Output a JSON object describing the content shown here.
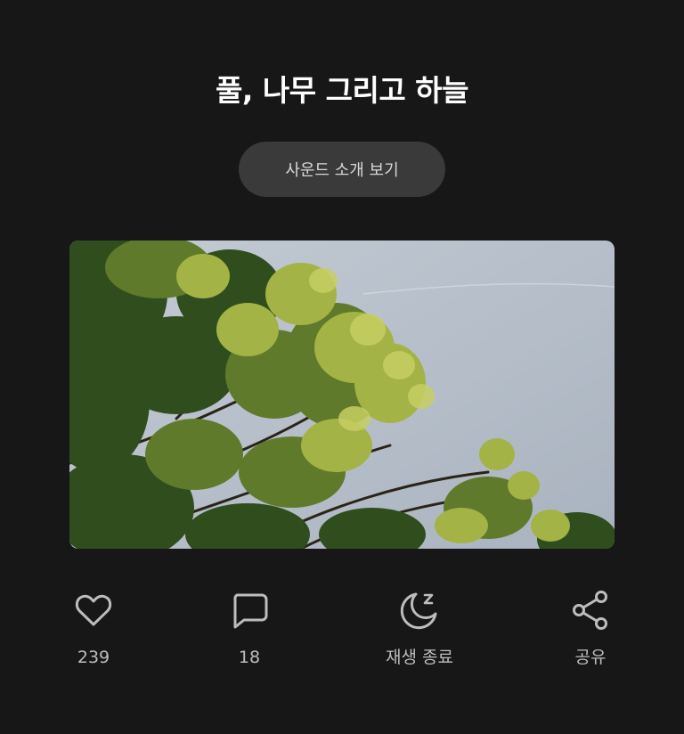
{
  "track": {
    "title": "풀, 나무 그리고 하늘",
    "intro_button_label": "사운드 소개 보기",
    "artwork_alt": "풀, 나무 그리고 하늘"
  },
  "actions": [
    {
      "icon": "heart-icon",
      "label": "239"
    },
    {
      "icon": "comment-icon",
      "label": "18"
    },
    {
      "icon": "sleep-moon-icon",
      "label": "재생 종료"
    },
    {
      "icon": "share-icon",
      "label": "공유"
    }
  ],
  "colors": {
    "background": "#171717",
    "title": "#ffffff",
    "pill_bg": "#3a3a3a",
    "pill_text": "#d8d8d8",
    "icon_stroke": "#bdbdbd",
    "sky": "#b7c0cb",
    "foliage_dark": "#2f4a1c",
    "foliage_light": "#9aa83f"
  }
}
